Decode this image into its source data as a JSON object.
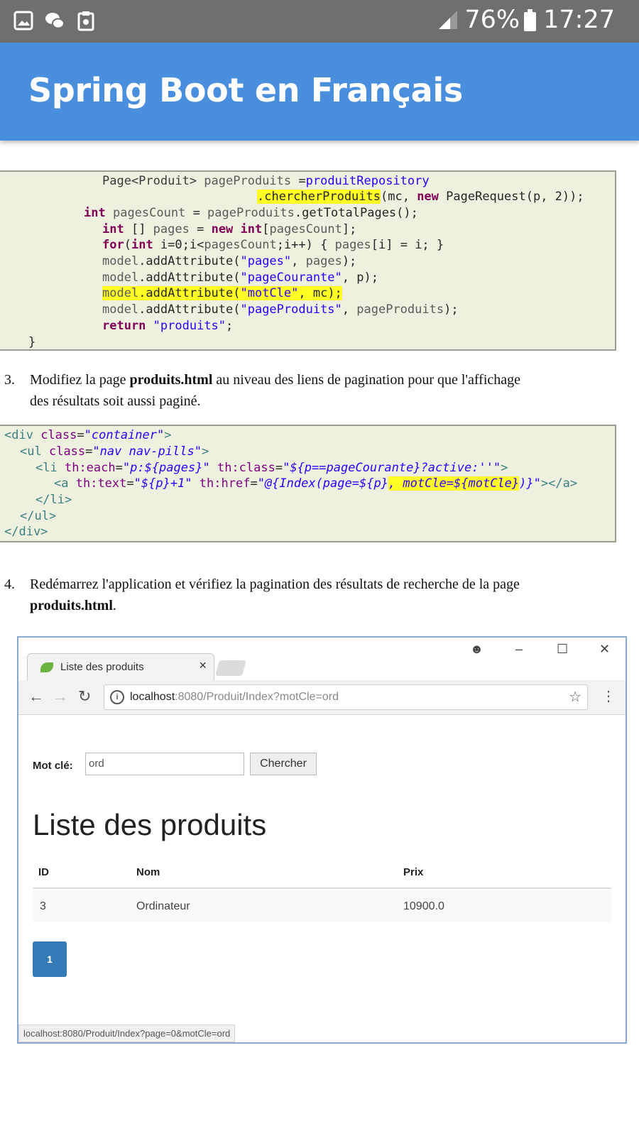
{
  "status_bar": {
    "battery": "76%",
    "time": "17:27",
    "icons": [
      "image-icon",
      "wechat-icon",
      "clipboard-icon",
      "signal-icon",
      "battery-icon"
    ]
  },
  "app_bar": {
    "title": "Spring Boot en Français"
  },
  "code_block_1": {
    "lines": [
      "Page<Produit> pageProduits =produitRepository",
      ".chercherProduits(mc, new PageRequest(p, 2));",
      "int pagesCount = pageProduits.getTotalPages();",
      "int [] pages = new int[pagesCount];",
      "for(int i=0;i<pagesCount;i++) { pages[i] = i; }",
      "model.addAttribute(\"pages\", pages);",
      "model.addAttribute(\"pageCourante\", p);",
      "model.addAttribute(\"motCle\", mc);",
      "model.addAttribute(\"pageProduits\", pageProduits);",
      "return \"produits\";",
      "}"
    ]
  },
  "step3": {
    "number": "3.",
    "text_before": "Modifiez la page ",
    "bold": "produits.html",
    "text_after": " au niveau des liens de pagination pour que l'affichage",
    "line2": "des résultats soit aussi paginé."
  },
  "code_block_2": {
    "lines": [
      "<div class=\"container\">",
      "<ul class=\"nav nav-pills\">",
      "<li th:each=\"p:${pages}\" th:class=\"${p==pageCourante}?active:''\">",
      "<a th:text=\"${p}+1\" th:href=\"@{Index(page=${p}, motCle=${motCle})}\"></a>",
      "</li>",
      "</ul>",
      "</div>"
    ]
  },
  "step4": {
    "number": "4.",
    "text": "Redémarrez l'application et vérifiez la pagination des résultats de recherche de la page",
    "bold": "produits.html",
    "end": "."
  },
  "browser": {
    "tab_title": "Liste des produits",
    "tab_close": "×",
    "url_host": "localhost",
    "url_path": ":8080/Produit/Index?motCle=ord",
    "window_buttons": {
      "account": "☻",
      "minimize": "–",
      "maximize": "☐",
      "close": "✕"
    },
    "search_label": "Mot clé:",
    "search_value": "ord",
    "search_button": "Chercher",
    "heading": "Liste des produits",
    "columns": [
      "ID",
      "Nom",
      "Prix"
    ],
    "rows": [
      [
        "3",
        "Ordinateur",
        "10900.0"
      ]
    ],
    "pagination": [
      "1"
    ],
    "status_url": "localhost:8080/Produit/Index?page=0&motCle=ord"
  }
}
